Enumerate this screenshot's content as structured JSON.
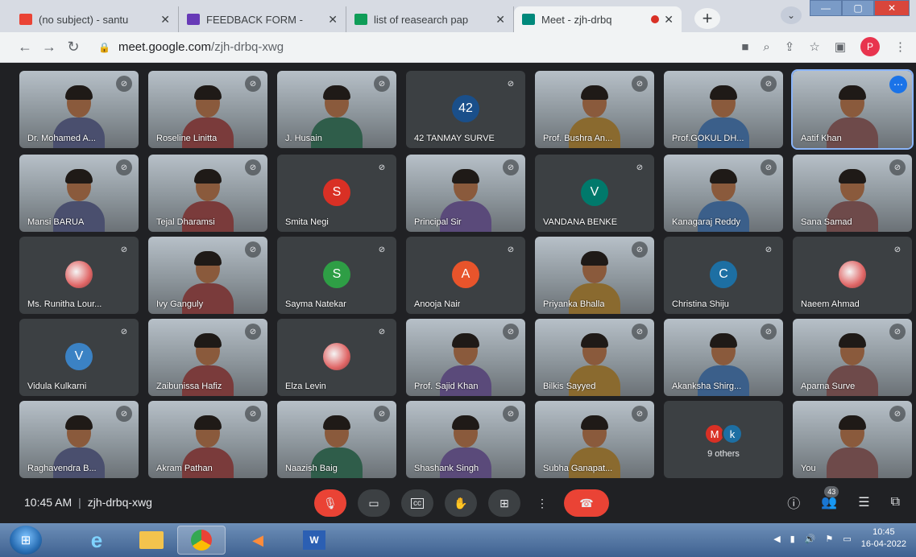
{
  "browser": {
    "tabs": [
      {
        "title": "(no subject) - santu",
        "icon": "gmail-icon",
        "color": "#ea4335",
        "active": false
      },
      {
        "title": "FEEDBACK FORM -",
        "icon": "forms-icon",
        "color": "#673ab7",
        "active": false
      },
      {
        "title": "list of reasearch pap",
        "icon": "sheets-icon",
        "color": "#0f9d58",
        "active": false
      },
      {
        "title": "Meet - zjh-drbq",
        "icon": "meet-icon",
        "color": "#00897b",
        "active": true,
        "recording": true
      }
    ],
    "new_tab_label": "+",
    "url_host": "meet.google.com",
    "url_path": "/zjh-drbq-xwg",
    "profile_initial": "P"
  },
  "meet": {
    "participants": [
      {
        "name": "Dr. Mohamed A...",
        "type": "camera"
      },
      {
        "name": "Roseline Linitta",
        "type": "camera"
      },
      {
        "name": "J. Husain",
        "type": "camera"
      },
      {
        "name": "42 TANMAY SURVE",
        "type": "avatar",
        "initial": "42",
        "color": "#1a4f8a"
      },
      {
        "name": "Prof. Bushra An...",
        "type": "camera"
      },
      {
        "name": "Prof.GOKUL DH...",
        "type": "camera"
      },
      {
        "name": "Aatif Khan",
        "type": "camera",
        "selected": true
      },
      {
        "name": "Mansi BARUA",
        "type": "camera"
      },
      {
        "name": "Tejal Dharamsi",
        "type": "camera"
      },
      {
        "name": "Smita Negi",
        "type": "avatar",
        "initial": "S",
        "color": "#d93025"
      },
      {
        "name": "Principal Sir",
        "type": "camera"
      },
      {
        "name": "VANDANA BENKE",
        "type": "avatar",
        "initial": "V",
        "color": "#00796b"
      },
      {
        "name": "Kanagaraj Reddy",
        "type": "camera"
      },
      {
        "name": "Sana Samad",
        "type": "camera"
      },
      {
        "name": "Ms. Runitha Lour...",
        "type": "photo"
      },
      {
        "name": "Ivy Ganguly",
        "type": "camera"
      },
      {
        "name": "Sayma Natekar",
        "type": "avatar",
        "initial": "S",
        "color": "#2e9e45"
      },
      {
        "name": "Anooja Nair",
        "type": "avatar",
        "initial": "A",
        "color": "#e8542b"
      },
      {
        "name": "Priyanka Bhalla",
        "type": "camera"
      },
      {
        "name": "Christina Shiju",
        "type": "avatar",
        "initial": "C",
        "color": "#1d6fa3"
      },
      {
        "name": "Naeem Ahmad",
        "type": "photo"
      },
      {
        "name": "Vidula Kulkarni",
        "type": "avatar",
        "initial": "V",
        "color": "#3b82c4"
      },
      {
        "name": "Zaibunissa Hafiz",
        "type": "camera"
      },
      {
        "name": "Elza Levin",
        "type": "photo"
      },
      {
        "name": "Prof. Sajid Khan",
        "type": "camera"
      },
      {
        "name": "Bilkis Sayyed",
        "type": "camera"
      },
      {
        "name": "Akanksha Shirg...",
        "type": "camera"
      },
      {
        "name": "Aparna Surve",
        "type": "camera"
      },
      {
        "name": "Raghavendra B...",
        "type": "camera"
      },
      {
        "name": "Akram Pathan",
        "type": "camera"
      },
      {
        "name": "Naazish Baig",
        "type": "camera"
      },
      {
        "name": "Shashank Singh",
        "type": "camera"
      },
      {
        "name": "Subha Ganapat...",
        "type": "camera"
      },
      {
        "name": "",
        "type": "others",
        "count_label": "9 others",
        "initials": [
          "M",
          "k"
        ],
        "colors": [
          "#d93025",
          "#1d6fa3"
        ]
      },
      {
        "name": "You",
        "type": "camera"
      }
    ]
  },
  "meetbar": {
    "time": "10:45 AM",
    "separator": "|",
    "meeting_code": "zjh-drbq-xwg",
    "people_count": "43"
  },
  "taskbar": {
    "clock_time": "10:45",
    "clock_date": "16-04-2022"
  }
}
